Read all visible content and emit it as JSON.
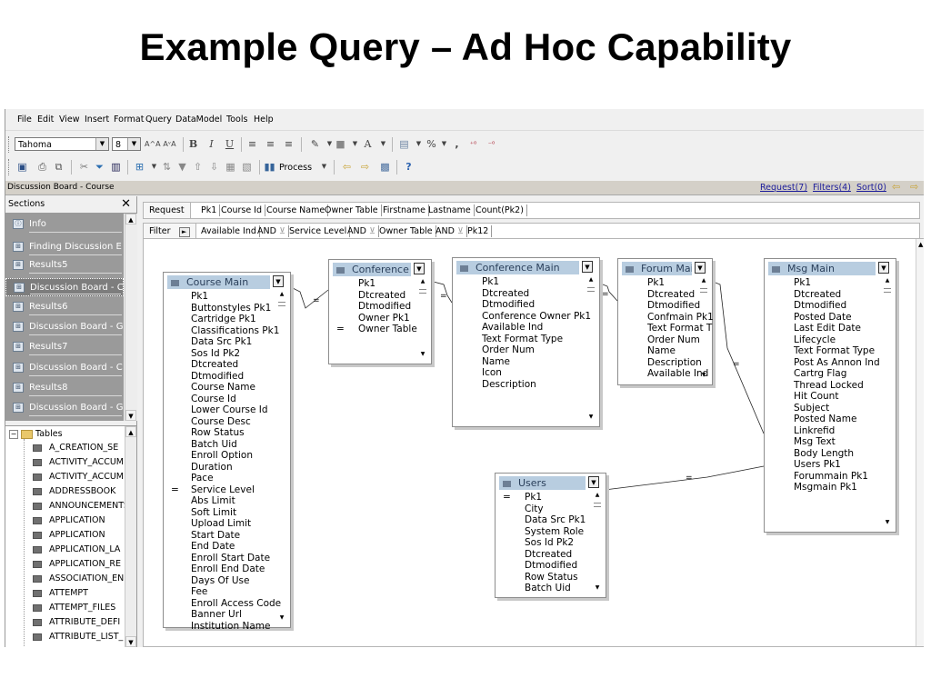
{
  "slide": {
    "title": "Example Query – Ad Hoc Capability"
  },
  "menu": [
    "File",
    "Edit",
    "View",
    "Insert",
    "Format",
    "Query",
    "DataModel",
    "Tools",
    "Help"
  ],
  "format_toolbar": {
    "font": "Tahoma",
    "size": "8",
    "bold": "B",
    "italic": "I",
    "underline": "U",
    "percent": "%"
  },
  "process_toolbar": {
    "process_label": "Process"
  },
  "document": {
    "title": "Discussion Board - Course",
    "links": [
      "Request(7)",
      "Filters(4)",
      "Sort(0)"
    ]
  },
  "sections": {
    "header": "Sections",
    "close": "✕",
    "items": [
      {
        "label": "Info",
        "icon": "info-icon",
        "selected": false
      },
      {
        "label": "Finding Discussion E",
        "icon": "query-icon",
        "selected": false
      },
      {
        "label": "Results5",
        "icon": "query-icon",
        "selected": false
      },
      {
        "label": "Discussion Board - C",
        "icon": "query-icon",
        "selected": true
      },
      {
        "label": "Results6",
        "icon": "query-icon",
        "selected": false
      },
      {
        "label": "Discussion Board - G",
        "icon": "query-icon",
        "selected": false
      },
      {
        "label": "Results7",
        "icon": "query-icon",
        "selected": false
      },
      {
        "label": "Discussion Board - C",
        "icon": "query-icon",
        "selected": false
      },
      {
        "label": "Results8",
        "icon": "query-icon",
        "selected": false
      },
      {
        "label": "Discussion Board - G",
        "icon": "query-icon",
        "selected": false
      }
    ]
  },
  "tables_tree": {
    "root": "Tables",
    "items": [
      "A_CREATION_SE",
      "ACTIVITY_ACCUM",
      "ACTIVITY_ACCUM",
      "ADDRESSBOOK",
      "ANNOUNCEMENTS",
      "APPLICATION",
      "APPLICATION",
      "APPLICATION_LA",
      "APPLICATION_RE",
      "ASSOCIATION_EN",
      "ATTEMPT",
      "ATTEMPT_FILES",
      "ATTRIBUTE_DEFI",
      "ATTRIBUTE_LIST_"
    ]
  },
  "request": {
    "label": "Request",
    "fields": [
      "Pk1",
      "Course Id",
      "Course Name",
      "Owner Table",
      "Firstname",
      "Lastname",
      "Count(Pk2)"
    ]
  },
  "filter": {
    "label": "Filter",
    "conditions": [
      "Available Ind",
      "AND",
      "Service Level",
      "AND",
      "Owner Table",
      "AND",
      "Pk12"
    ]
  },
  "tables": {
    "course_main": {
      "title": "Course Main",
      "fields": [
        "Pk1",
        "Buttonstyles Pk1",
        "Cartridge Pk1",
        "Classifications Pk1",
        "Data Src Pk1",
        "Sos Id Pk2",
        "Dtcreated",
        "Dtmodified",
        "Course Name",
        "Course Id",
        "Lower Course Id",
        "Course Desc",
        "Row Status",
        "Batch Uid",
        "Enroll Option",
        "Duration",
        "Pace",
        "Service Level",
        "Abs Limit",
        "Soft Limit",
        "Upload Limit",
        "Start Date",
        "End Date",
        "Enroll Start Date",
        "Enroll End Date",
        "Days Of Use",
        "Fee",
        "Enroll Access Code",
        "Banner Url",
        "Institution Name"
      ],
      "eq_marker": "="
    },
    "conference_owner": {
      "title": "Conference O",
      "fields": [
        "Pk1",
        "Dtcreated",
        "Dtmodified",
        "Owner Pk1",
        "Owner Table"
      ],
      "eq_marker": "="
    },
    "conference_main": {
      "title": "Conference Main",
      "fields": [
        "Pk1",
        "Dtcreated",
        "Dtmodified",
        "Conference Owner Pk1",
        "Available Ind",
        "Text Format Type",
        "Order Num",
        "Name",
        "Icon",
        "Description"
      ]
    },
    "forum_main": {
      "title": "Forum Main",
      "fields": [
        "Pk1",
        "Dtcreated",
        "Dtmodified",
        "Confmain Pk1",
        "Text Format T",
        "Order Num",
        "Name",
        "Description",
        "Available Ind"
      ]
    },
    "msg_main": {
      "title": "Msg Main",
      "fields": [
        "Pk1",
        "Dtcreated",
        "Dtmodified",
        "Posted Date",
        "Last Edit Date",
        "Lifecycle",
        "Text Format Type",
        "Post As Annon Ind",
        "Cartrg Flag",
        "Thread Locked",
        "Hit Count",
        "Subject",
        "Posted Name",
        "Linkrefid",
        "Msg Text",
        "Body Length",
        "Users Pk1",
        "Forummain Pk1",
        "Msgmain Pk1"
      ]
    },
    "users": {
      "title": "Users",
      "fields": [
        "Pk1",
        "City",
        "Data Src Pk1",
        "System Role",
        "Sos Id Pk2",
        "Dtcreated",
        "Dtmodified",
        "Row Status",
        "Batch Uid"
      ],
      "eq_marker": "="
    }
  },
  "join_marker": "="
}
